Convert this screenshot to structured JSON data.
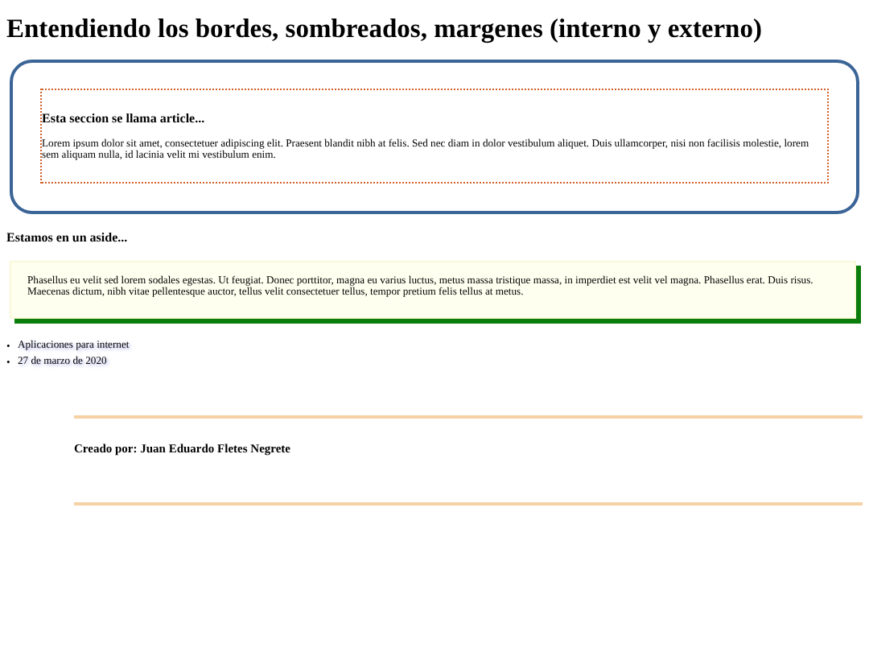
{
  "title": "Entendiendo los bordes, sombreados, margenes (interno y externo)",
  "article": {
    "heading": "Esta seccion se llama article...",
    "text": "Lorem ipsum dolor sit amet, consectetuer adipiscing elit. Praesent blandit nibh at felis. Sed nec diam in dolor vestibulum aliquet. Duis ullamcorper, nisi non facilisis molestie, lorem sem aliquam nulla, id lacinia velit mi vestibulum enim."
  },
  "aside": {
    "heading": "Estamos en un aside...",
    "text": "Phasellus eu velit sed lorem sodales egestas. Ut feugiat. Donec porttitor, magna eu varius luctus, metus massa tristique massa, in imperdiet est velit vel magna. Phasellus erat. Duis risus. Maecenas dictum, nibh vitae pellentesque auctor, tellus velit consectetuer tellus, tempor pretium felis tellus at metus."
  },
  "list": [
    {
      "marker": "•",
      "text": "Aplicaciones para internet"
    },
    {
      "marker": "•",
      "text": "27 de marzo de 2020"
    }
  ],
  "footer": {
    "text": "Creado por: Juan Eduardo Fletes Negrete"
  }
}
